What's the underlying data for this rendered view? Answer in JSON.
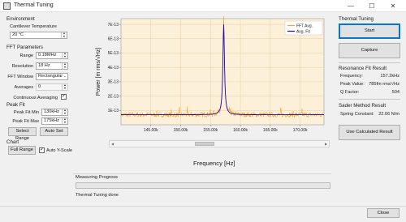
{
  "window": {
    "title": "Thermal Tuning",
    "min": "—",
    "max": "☐",
    "close": "✕"
  },
  "environment": {
    "title": "Environment",
    "cantilever_label": "Cantilever Temperature",
    "cantilever_value": "20 °C"
  },
  "fft": {
    "title": "FFT Parameters",
    "range_label": "Range",
    "range_value": "0.18MHz",
    "resolution_label": "Resolution",
    "resolution_value": "18 Hz",
    "window_label": "FFT Window",
    "window_value": "Rectangular",
    "averages_label": "Averages",
    "averages_value": "0",
    "continuous_label": "Continuous Averaging",
    "continuous_checked": "✓"
  },
  "peak_fit": {
    "title": "Peak Fit",
    "min_label": "Peak Fit Min",
    "min_value": "130kHz",
    "max_label": "Peak Fit Max",
    "max_value": "175kHz",
    "select_range": "Select Range",
    "auto_set": "Auto Set"
  },
  "chart_panel": {
    "title": "Chart",
    "full_range": "Full Range",
    "auto_y_label": "Auto Y-Scale",
    "auto_y_checked": "✓"
  },
  "thermal_tuning": {
    "title": "Thermal Tuning",
    "start": "Start",
    "capture": "Capture"
  },
  "resonance": {
    "title": "Resonance Fit Result",
    "frequency_label": "Frequency:",
    "frequency_value": "157.2kHz",
    "peak_label": "Peak Value:",
    "peak_value": "785fm rms/√Hz",
    "q_label": "Q Factor:",
    "q_value": "504"
  },
  "sader": {
    "title": "Sader Method Result",
    "spring_label": "Spring Constant:",
    "spring_value": "22.66 N/m",
    "use_calculated": "Use Calculated Result"
  },
  "measuring": {
    "title": "Measuring Progress",
    "status": "Thermal Tuning done",
    "progress": 0
  },
  "footer": {
    "close": "Close"
  },
  "colors": {
    "plot_bg": "#fdf0d8",
    "fft_avg": "#f5a623",
    "avg_fit": "#1a0ab0",
    "accent": "#0078d7"
  },
  "chart_data": {
    "type": "line",
    "xlabel": "Frequency [Hz]",
    "ylabel": "Power [m rms/√Hz]",
    "xlim": [
      140000,
      174000
    ],
    "ylim": [
      0,
      7.4e-13
    ],
    "x_ticks": [
      145000,
      150000,
      155000,
      160000,
      165000,
      170000
    ],
    "x_tick_labels": [
      "145.00k",
      "150.00k",
      "155.00k",
      "160.00k",
      "165.00k",
      "170.00k"
    ],
    "y_ticks": [
      1e-13,
      2e-13,
      3e-13,
      4e-13,
      5e-13,
      6e-13,
      7e-13
    ],
    "y_tick_labels": [
      "1E-13",
      "2E-13",
      "3E-13",
      "4E-13",
      "5E-13",
      "6E-13",
      "7E-13"
    ],
    "grid": true,
    "legend": "top-right",
    "series": [
      {
        "name": "FFT Avg.",
        "color": "#f5a623",
        "noisy": true,
        "baseline": 7e-14,
        "peak_x": 157200,
        "peak_y": 7.1e-13,
        "fwhm": 320
      },
      {
        "name": "Avg. Fit",
        "color": "#1a0ab0",
        "noisy": false,
        "baseline": 7e-14,
        "peak_x": 157200,
        "peak_y": 7e-13,
        "fwhm": 320
      }
    ]
  }
}
